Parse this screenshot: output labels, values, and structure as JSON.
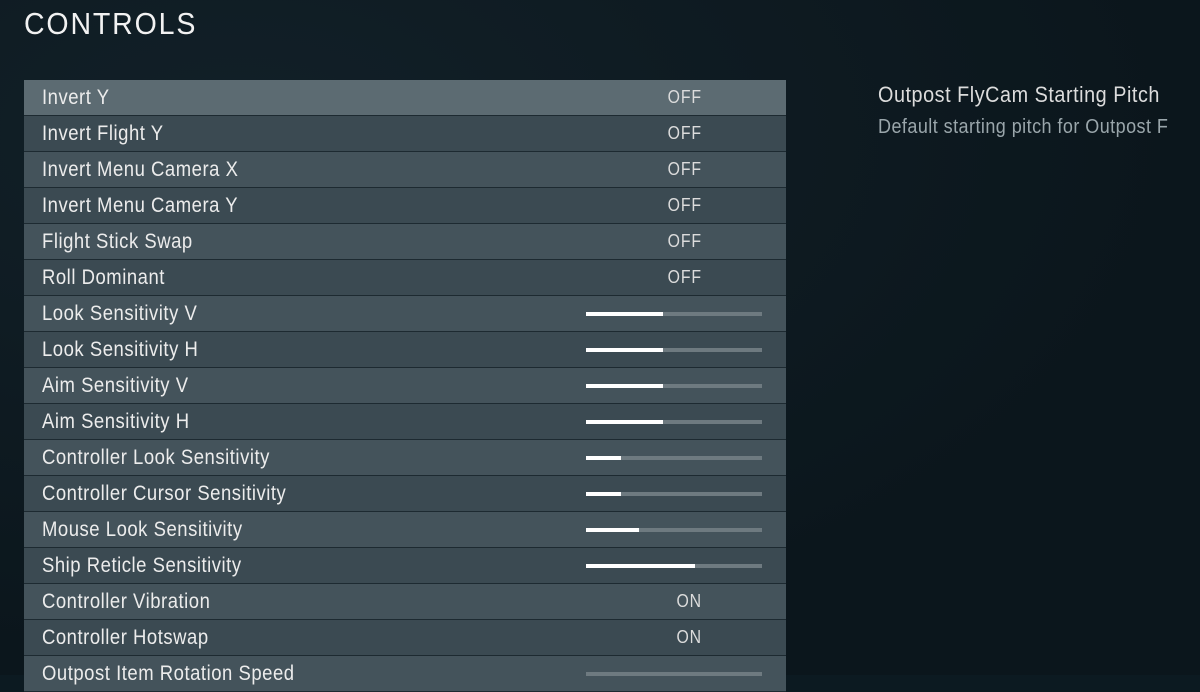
{
  "page": {
    "title": "CONTROLS"
  },
  "help": {
    "title": "Outpost FlyCam Starting Pitch",
    "body": "Default starting pitch for Outpost F"
  },
  "rows": [
    {
      "label": "Invert Y",
      "type": "toggle",
      "value": "OFF",
      "highlighted": true
    },
    {
      "label": "Invert Flight Y",
      "type": "toggle",
      "value": "OFF",
      "highlighted": false
    },
    {
      "label": "Invert Menu Camera X",
      "type": "toggle",
      "value": "OFF",
      "highlighted": false
    },
    {
      "label": "Invert Menu Camera Y",
      "type": "toggle",
      "value": "OFF",
      "highlighted": false
    },
    {
      "label": "Flight Stick Swap",
      "type": "toggle",
      "value": "OFF",
      "highlighted": false
    },
    {
      "label": "Roll Dominant",
      "type": "toggle",
      "value": "OFF",
      "highlighted": false
    },
    {
      "label": "Look Sensitivity V",
      "type": "slider",
      "value": 44,
      "highlighted": false
    },
    {
      "label": "Look Sensitivity H",
      "type": "slider",
      "value": 44,
      "highlighted": false
    },
    {
      "label": "Aim Sensitivity V",
      "type": "slider",
      "value": 44,
      "highlighted": false
    },
    {
      "label": "Aim Sensitivity H",
      "type": "slider",
      "value": 44,
      "highlighted": false
    },
    {
      "label": "Controller Look Sensitivity",
      "type": "slider",
      "value": 20,
      "highlighted": false
    },
    {
      "label": "Controller Cursor Sensitivity",
      "type": "slider",
      "value": 20,
      "highlighted": false
    },
    {
      "label": "Mouse Look Sensitivity",
      "type": "slider",
      "value": 30,
      "highlighted": false
    },
    {
      "label": "Ship Reticle Sensitivity",
      "type": "slider",
      "value": 62,
      "highlighted": false
    },
    {
      "label": "Controller Vibration",
      "type": "toggle",
      "value": "ON",
      "highlighted": false
    },
    {
      "label": "Controller Hotswap",
      "type": "toggle",
      "value": "ON",
      "highlighted": false
    },
    {
      "label": "Outpost Item Rotation Speed",
      "type": "slider",
      "value": 0,
      "highlighted": false
    }
  ]
}
